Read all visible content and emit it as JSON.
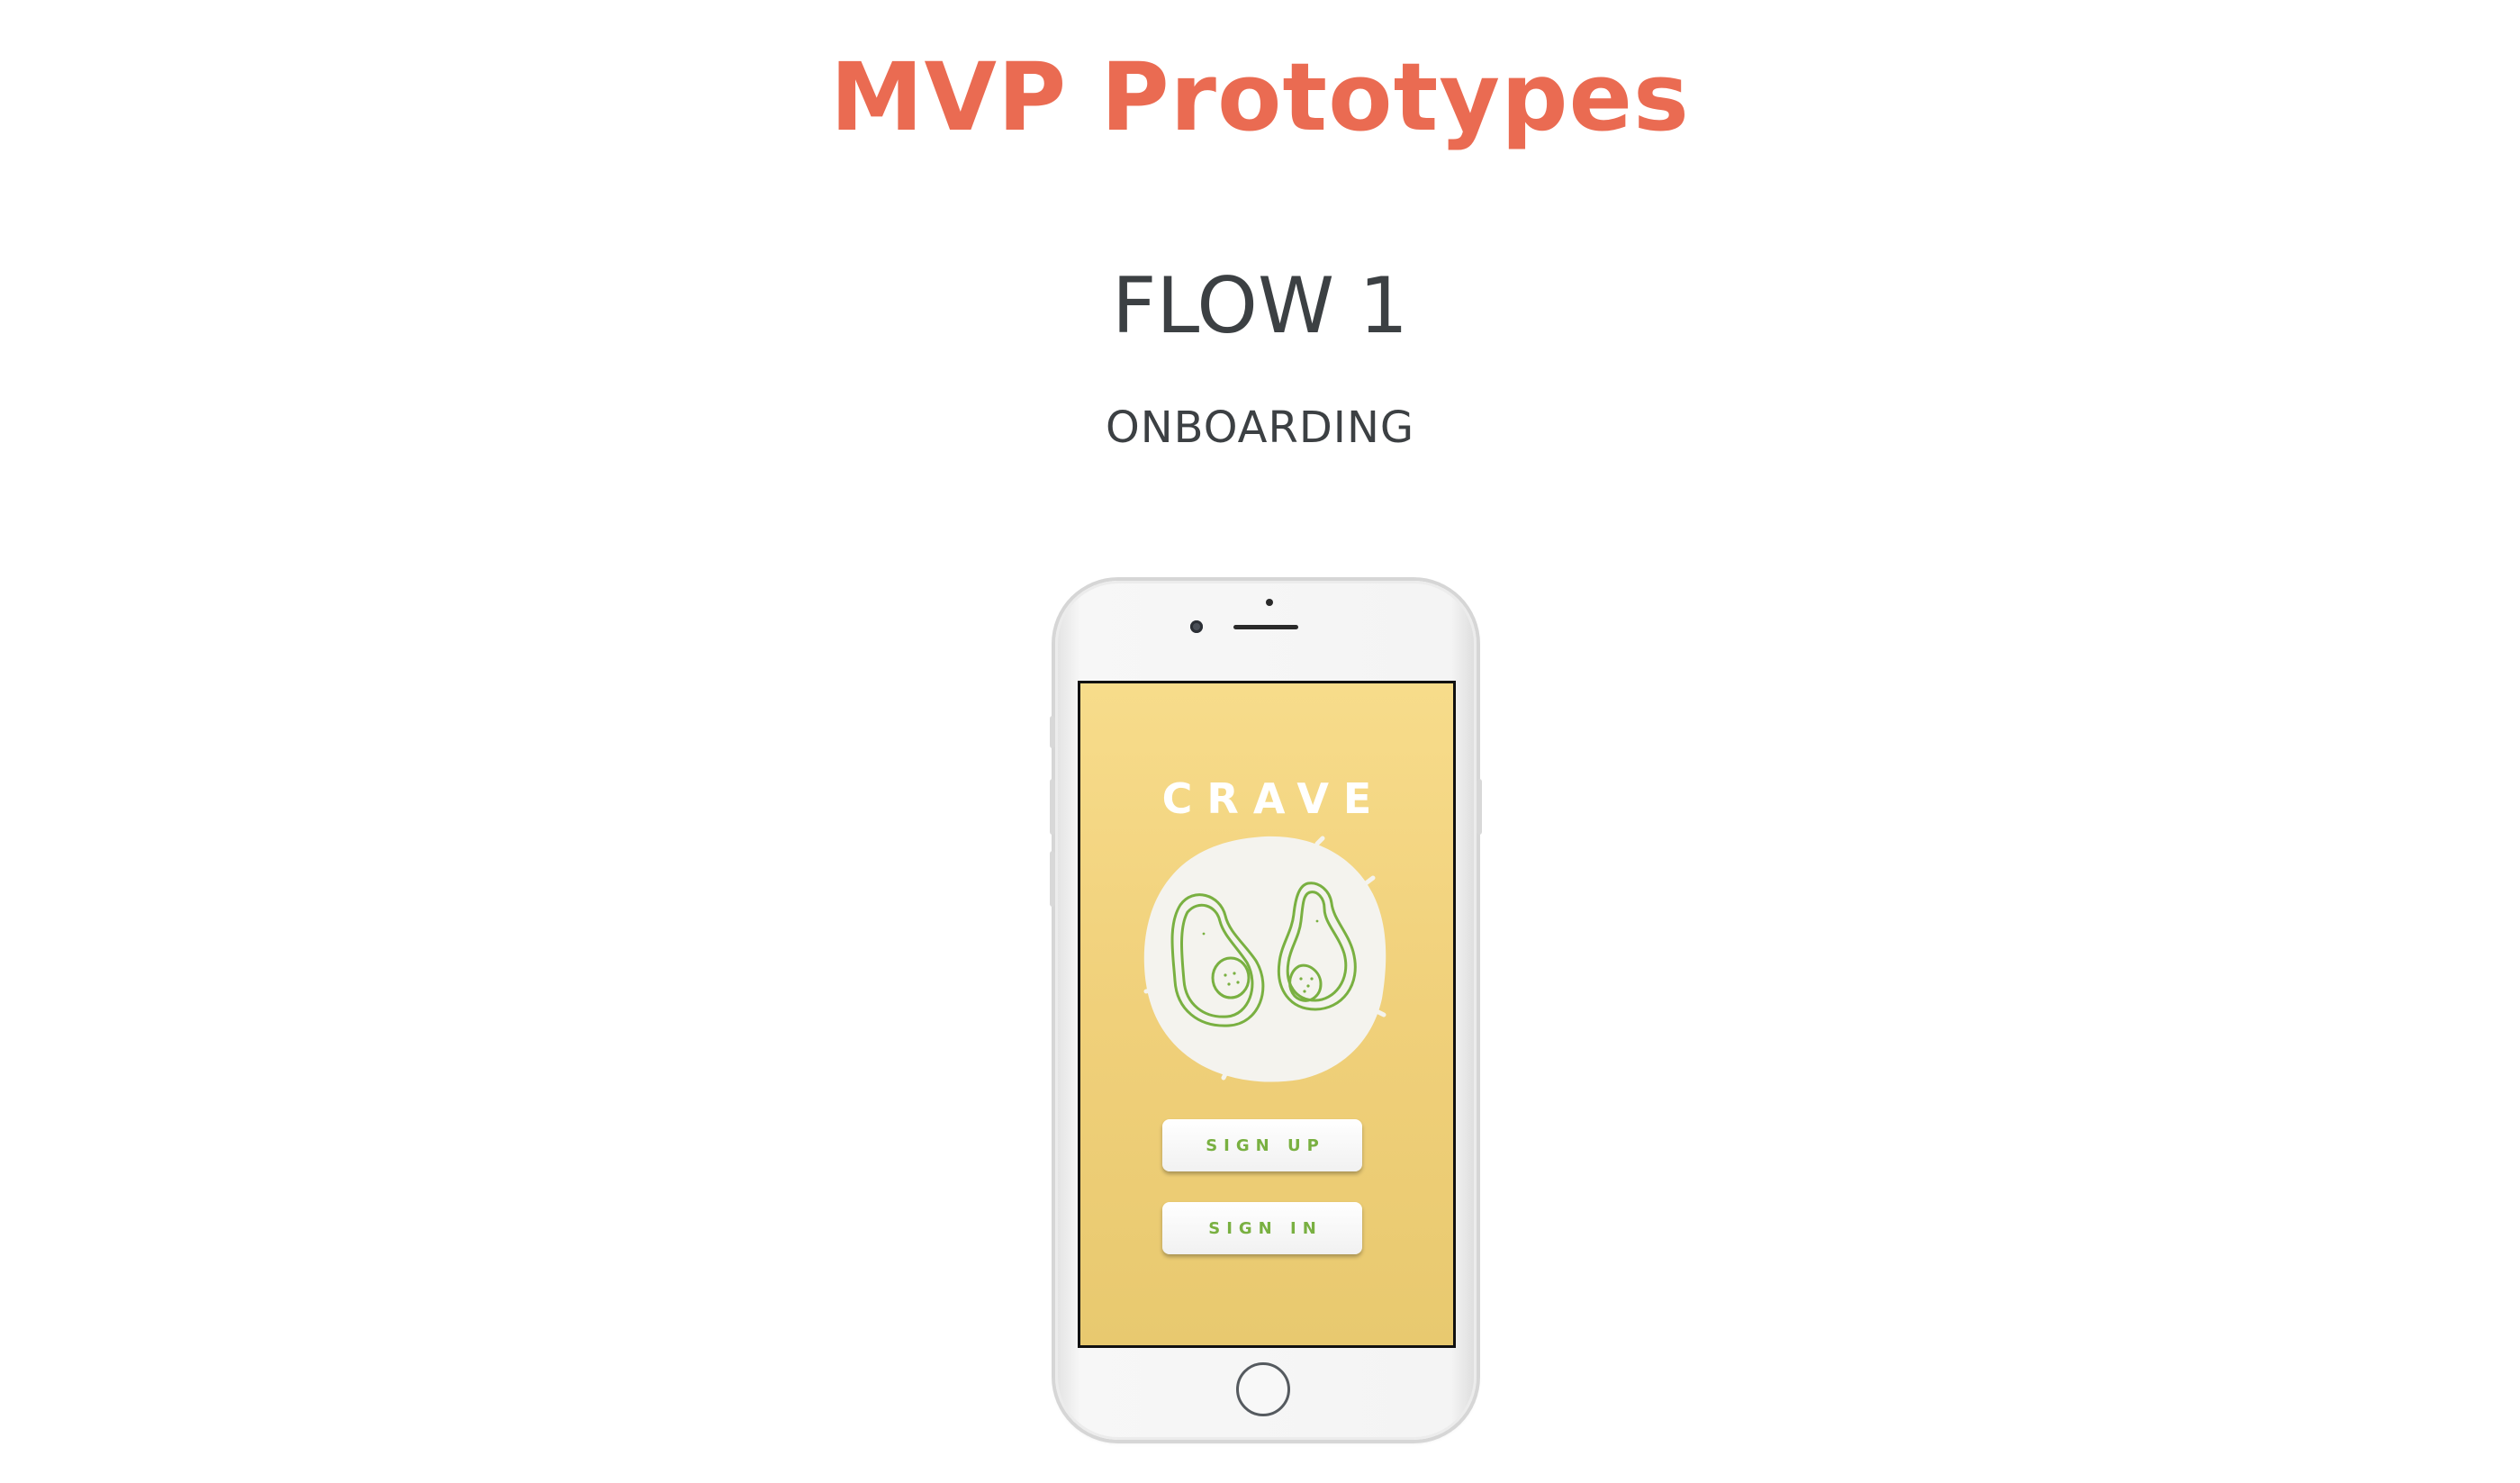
{
  "header": {
    "title": "MVP Prototypes",
    "title_color": "#ea6b52"
  },
  "section": {
    "flow_title": "FLOW 1",
    "flow_subtitle": "ONBOARDING",
    "text_color": "#3c4043"
  },
  "phone": {
    "app": {
      "name": "CRAVE",
      "logo_icon": "avocado-icon",
      "accent_color": "#79b041",
      "screen_color": "#f2d37d",
      "buttons": {
        "sign_up_label": "SIGN UP",
        "sign_in_label": "SIGN IN"
      }
    },
    "home_button_icon": "home-button"
  }
}
